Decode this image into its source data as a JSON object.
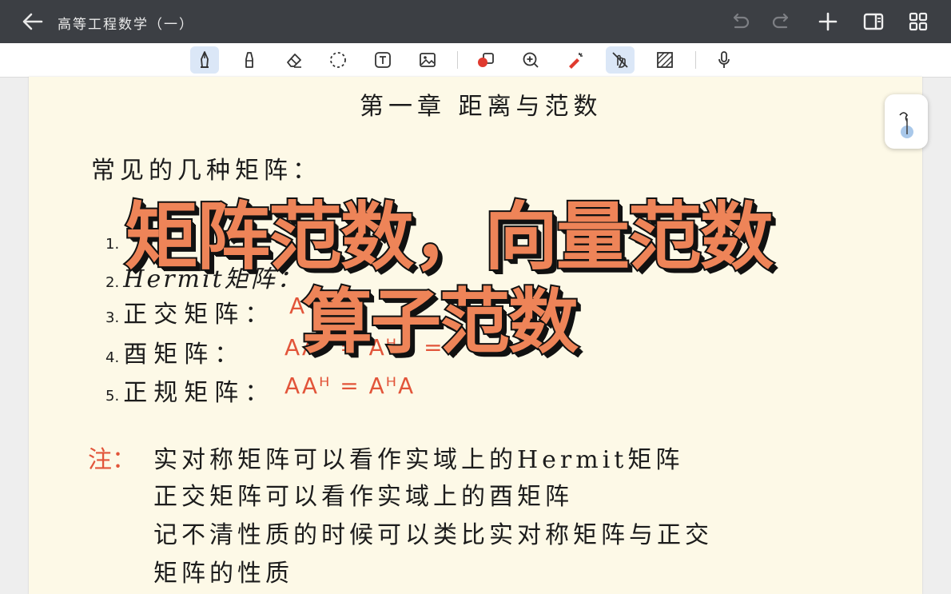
{
  "header": {
    "title": "高等工程数学（一）",
    "back_icon": "arrow-left-icon",
    "actions": [
      "undo-icon",
      "redo-icon",
      "plus-icon",
      "panel-icon",
      "grid-icon"
    ]
  },
  "toolbar": {
    "tools": [
      {
        "name": "pen-tool",
        "icon": "fountain-pen-icon",
        "active": true
      },
      {
        "name": "highlighter-tool",
        "icon": "marker-icon",
        "active": false
      },
      {
        "name": "eraser-tool",
        "icon": "eraser-icon",
        "active": false
      },
      {
        "name": "lasso-tool",
        "icon": "lasso-icon",
        "active": false
      },
      {
        "name": "text-tool",
        "icon": "text-box-icon",
        "active": false
      },
      {
        "name": "image-tool",
        "icon": "image-icon",
        "active": false
      },
      {
        "name": "shapes-tool",
        "icon": "shapes-icon",
        "active": false
      },
      {
        "name": "zoom-tool",
        "icon": "zoom-in-icon",
        "active": false
      },
      {
        "name": "laser-tool",
        "icon": "laser-pointer-icon",
        "active": false
      },
      {
        "name": "hand-draw-tool",
        "icon": "no-touch-icon",
        "active": true
      },
      {
        "name": "pattern-tool",
        "icon": "hatch-icon",
        "active": false
      },
      {
        "name": "mic-tool",
        "icon": "microphone-icon",
        "active": false
      }
    ],
    "active_color": "#dbe7f7"
  },
  "note": {
    "chapter_title": "第一章  距离与范数",
    "heading": "常见的几种矩阵：",
    "items": [
      {
        "num": "1.",
        "label": "",
        "formula": ""
      },
      {
        "num": "2.",
        "label": "Hermit矩阵：",
        "formula": ""
      },
      {
        "num": "3.",
        "label": "正交矩阵：",
        "formula": "A"
      },
      {
        "num": "4.",
        "label": "酉矩阵：",
        "formula": "AAᴴ = AᴴA = I"
      },
      {
        "num": "5.",
        "label": "正规矩阵：",
        "formula": "AAᴴ = AᴴA"
      }
    ],
    "remark_label": "注：",
    "remark_lines": [
      "实对称矩阵可以看作实域上的Hermit矩阵",
      "正交矩阵可以看作实域上的酉矩阵",
      "记不清性质的时候可以类比实对称矩阵与正交",
      "矩阵的性质"
    ],
    "accent_color": "#e2553a"
  },
  "overlay": {
    "line1": "矩阵范数，向量范数",
    "line2": "算子范数",
    "fill_color": "#ee8458"
  },
  "float_button": {
    "icon": "pen-settings-icon"
  }
}
